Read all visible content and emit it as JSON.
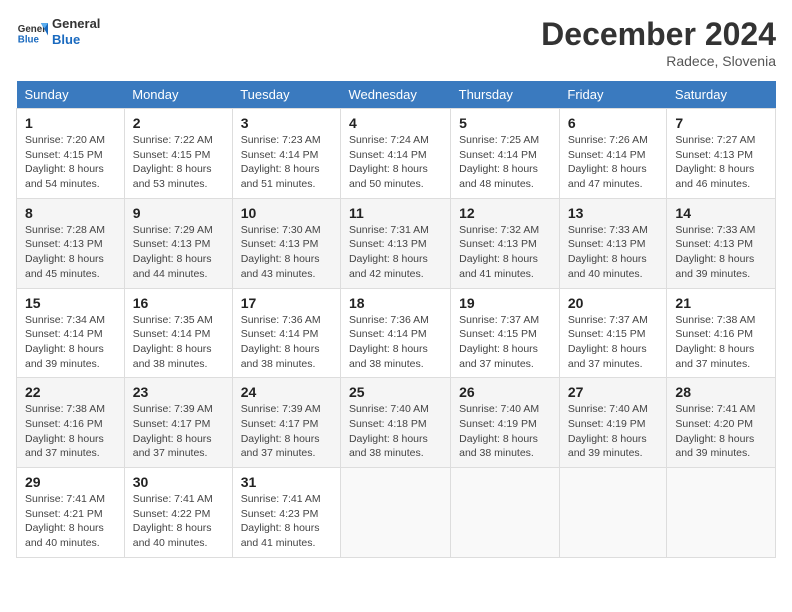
{
  "header": {
    "logo_general": "General",
    "logo_blue": "Blue",
    "month_title": "December 2024",
    "location": "Radece, Slovenia"
  },
  "weekdays": [
    "Sunday",
    "Monday",
    "Tuesday",
    "Wednesday",
    "Thursday",
    "Friday",
    "Saturday"
  ],
  "weeks": [
    [
      {
        "day": "1",
        "sunrise": "7:20 AM",
        "sunset": "4:15 PM",
        "daylight": "8 hours and 54 minutes."
      },
      {
        "day": "2",
        "sunrise": "7:22 AM",
        "sunset": "4:15 PM",
        "daylight": "8 hours and 53 minutes."
      },
      {
        "day": "3",
        "sunrise": "7:23 AM",
        "sunset": "4:14 PM",
        "daylight": "8 hours and 51 minutes."
      },
      {
        "day": "4",
        "sunrise": "7:24 AM",
        "sunset": "4:14 PM",
        "daylight": "8 hours and 50 minutes."
      },
      {
        "day": "5",
        "sunrise": "7:25 AM",
        "sunset": "4:14 PM",
        "daylight": "8 hours and 48 minutes."
      },
      {
        "day": "6",
        "sunrise": "7:26 AM",
        "sunset": "4:14 PM",
        "daylight": "8 hours and 47 minutes."
      },
      {
        "day": "7",
        "sunrise": "7:27 AM",
        "sunset": "4:13 PM",
        "daylight": "8 hours and 46 minutes."
      }
    ],
    [
      {
        "day": "8",
        "sunrise": "7:28 AM",
        "sunset": "4:13 PM",
        "daylight": "8 hours and 45 minutes."
      },
      {
        "day": "9",
        "sunrise": "7:29 AM",
        "sunset": "4:13 PM",
        "daylight": "8 hours and 44 minutes."
      },
      {
        "day": "10",
        "sunrise": "7:30 AM",
        "sunset": "4:13 PM",
        "daylight": "8 hours and 43 minutes."
      },
      {
        "day": "11",
        "sunrise": "7:31 AM",
        "sunset": "4:13 PM",
        "daylight": "8 hours and 42 minutes."
      },
      {
        "day": "12",
        "sunrise": "7:32 AM",
        "sunset": "4:13 PM",
        "daylight": "8 hours and 41 minutes."
      },
      {
        "day": "13",
        "sunrise": "7:33 AM",
        "sunset": "4:13 PM",
        "daylight": "8 hours and 40 minutes."
      },
      {
        "day": "14",
        "sunrise": "7:33 AM",
        "sunset": "4:13 PM",
        "daylight": "8 hours and 39 minutes."
      }
    ],
    [
      {
        "day": "15",
        "sunrise": "7:34 AM",
        "sunset": "4:14 PM",
        "daylight": "8 hours and 39 minutes."
      },
      {
        "day": "16",
        "sunrise": "7:35 AM",
        "sunset": "4:14 PM",
        "daylight": "8 hours and 38 minutes."
      },
      {
        "day": "17",
        "sunrise": "7:36 AM",
        "sunset": "4:14 PM",
        "daylight": "8 hours and 38 minutes."
      },
      {
        "day": "18",
        "sunrise": "7:36 AM",
        "sunset": "4:14 PM",
        "daylight": "8 hours and 38 minutes."
      },
      {
        "day": "19",
        "sunrise": "7:37 AM",
        "sunset": "4:15 PM",
        "daylight": "8 hours and 37 minutes."
      },
      {
        "day": "20",
        "sunrise": "7:37 AM",
        "sunset": "4:15 PM",
        "daylight": "8 hours and 37 minutes."
      },
      {
        "day": "21",
        "sunrise": "7:38 AM",
        "sunset": "4:16 PM",
        "daylight": "8 hours and 37 minutes."
      }
    ],
    [
      {
        "day": "22",
        "sunrise": "7:38 AM",
        "sunset": "4:16 PM",
        "daylight": "8 hours and 37 minutes."
      },
      {
        "day": "23",
        "sunrise": "7:39 AM",
        "sunset": "4:17 PM",
        "daylight": "8 hours and 37 minutes."
      },
      {
        "day": "24",
        "sunrise": "7:39 AM",
        "sunset": "4:17 PM",
        "daylight": "8 hours and 37 minutes."
      },
      {
        "day": "25",
        "sunrise": "7:40 AM",
        "sunset": "4:18 PM",
        "daylight": "8 hours and 38 minutes."
      },
      {
        "day": "26",
        "sunrise": "7:40 AM",
        "sunset": "4:19 PM",
        "daylight": "8 hours and 38 minutes."
      },
      {
        "day": "27",
        "sunrise": "7:40 AM",
        "sunset": "4:19 PM",
        "daylight": "8 hours and 39 minutes."
      },
      {
        "day": "28",
        "sunrise": "7:41 AM",
        "sunset": "4:20 PM",
        "daylight": "8 hours and 39 minutes."
      }
    ],
    [
      {
        "day": "29",
        "sunrise": "7:41 AM",
        "sunset": "4:21 PM",
        "daylight": "8 hours and 40 minutes."
      },
      {
        "day": "30",
        "sunrise": "7:41 AM",
        "sunset": "4:22 PM",
        "daylight": "8 hours and 40 minutes."
      },
      {
        "day": "31",
        "sunrise": "7:41 AM",
        "sunset": "4:23 PM",
        "daylight": "8 hours and 41 minutes."
      },
      null,
      null,
      null,
      null
    ]
  ],
  "labels": {
    "sunrise": "Sunrise:",
    "sunset": "Sunset:",
    "daylight": "Daylight:"
  }
}
